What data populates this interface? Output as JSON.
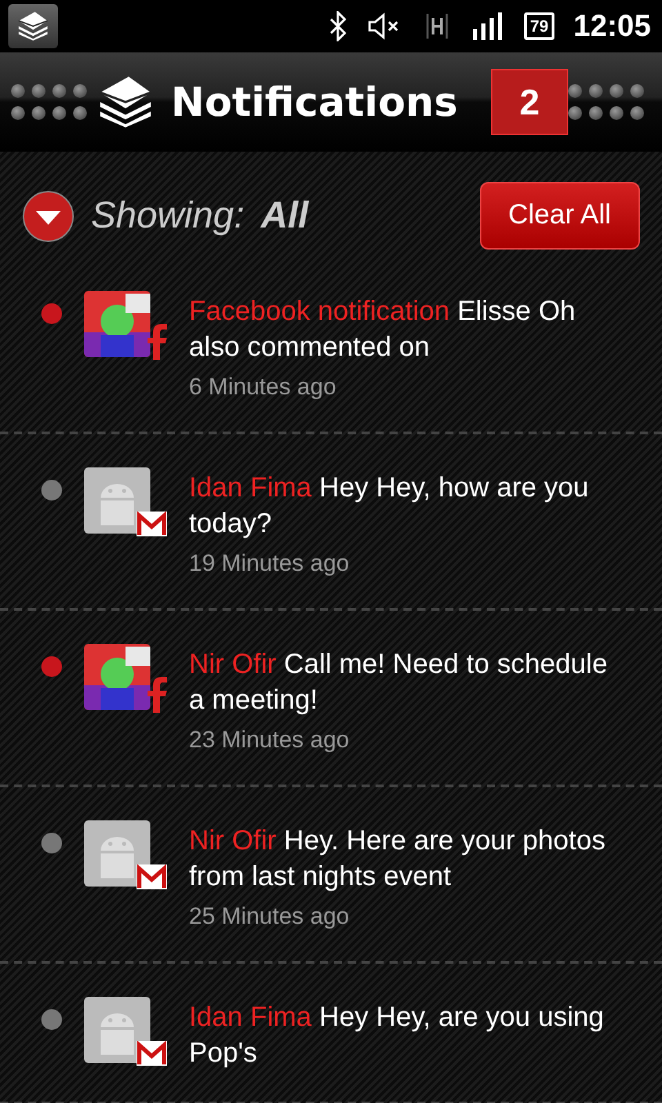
{
  "status_bar": {
    "battery": "79",
    "time": "12:05"
  },
  "header": {
    "title": "Notifications",
    "count": "2"
  },
  "filter": {
    "label": "Showing:",
    "value": "All",
    "button": "Clear All"
  },
  "notifications": [
    {
      "unread": true,
      "kind": "facebook",
      "sender": "Facebook notification",
      "message": "Elisse Oh also commented on",
      "time": "6 Minutes ago"
    },
    {
      "unread": false,
      "kind": "gmail",
      "avatar": {
        "kind": "android"
      },
      "sender": "Idan Fima",
      "message": "Hey Hey, how are you today?",
      "time": "19 Minutes ago"
    },
    {
      "unread": true,
      "kind": "facebook",
      "sender": "Nir Ofir",
      "message": "Call me! Need to schedule a meeting!",
      "time": "23 Minutes ago"
    },
    {
      "unread": false,
      "kind": "gmail",
      "avatar": {
        "kind": "android"
      },
      "sender": "Nir Ofir",
      "message": "Hey. Here are your photos from last nights event",
      "time": "25 Minutes ago"
    },
    {
      "unread": false,
      "kind": "gmail",
      "avatar": {
        "kind": "android"
      },
      "sender": "Idan Fima",
      "message": "Hey Hey, are you using Pop's"
    }
  ]
}
